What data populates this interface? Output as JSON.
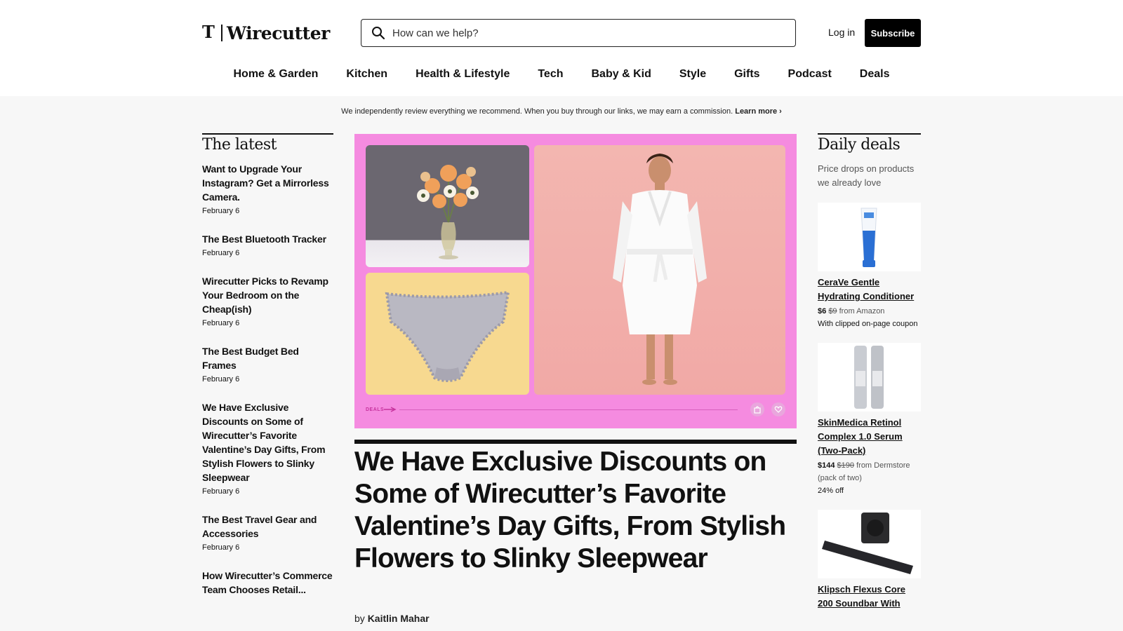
{
  "header": {
    "logo_t": "𝕿",
    "logo_text": "Wirecutter",
    "search_placeholder": "How can we help?",
    "login_label": "Log in",
    "subscribe_label": "Subscribe"
  },
  "nav": {
    "items": [
      "Home & Garden",
      "Kitchen",
      "Health & Lifestyle",
      "Tech",
      "Baby & Kid",
      "Style",
      "Gifts",
      "Podcast",
      "Deals"
    ]
  },
  "disclosure": {
    "text": "We independently review everything we recommend. When you buy through our links, we may earn a commission.",
    "link": "Learn more ›"
  },
  "latest": {
    "title": "The latest",
    "items": [
      {
        "title": "Want to Upgrade Your Instagram? Get a Mirrorless Camera.",
        "date": "February 6"
      },
      {
        "title": "The Best Bluetooth Tracker",
        "date": "February 6"
      },
      {
        "title": "Wirecutter Picks to Revamp Your Bedroom on the Cheap(ish)",
        "date": "February 6"
      },
      {
        "title": "The Best Budget Bed Frames",
        "date": "February 6"
      },
      {
        "title": "We Have Exclusive Discounts on Some of Wirecutter’s Favorite Valentine’s Day Gifts, From Stylish Flowers to Slinky Sleepwear",
        "date": "February 6"
      },
      {
        "title": "The Best Travel Gear and Accessories",
        "date": "February 6"
      },
      {
        "title": "How Wirecutter’s Commerce Team Chooses Retail...",
        "date": ""
      }
    ]
  },
  "hero": {
    "tag": "DEALS",
    "title": "We Have Exclusive Discounts on Some of Wirecutter’s Favorite Valentine’s Day Gifts, From Stylish Flowers to Slinky Sleepwear",
    "byline_prefix": "by",
    "author": "Kaitlin Mahar"
  },
  "deals": {
    "title": "Daily deals",
    "subtitle": "Price drops on products we already love",
    "items": [
      {
        "title": "CeraVe Gentle Hydrating Conditioner",
        "price": "$6",
        "was": "$9",
        "source": "from Amazon",
        "note": "With clipped on-page coupon"
      },
      {
        "title": "SkinMedica Retinol Complex 1.0 Serum (Two-Pack)",
        "price": "$144",
        "was": "$190",
        "source": "from Dermstore (pack of two)",
        "note": "24% off"
      },
      {
        "title": "Klipsch Flexus Core 200 Soundbar With",
        "price": "",
        "was": "",
        "source": "",
        "note": ""
      }
    ]
  },
  "colors": {
    "hero_bg": "#f58be0",
    "accent": "#000000"
  }
}
